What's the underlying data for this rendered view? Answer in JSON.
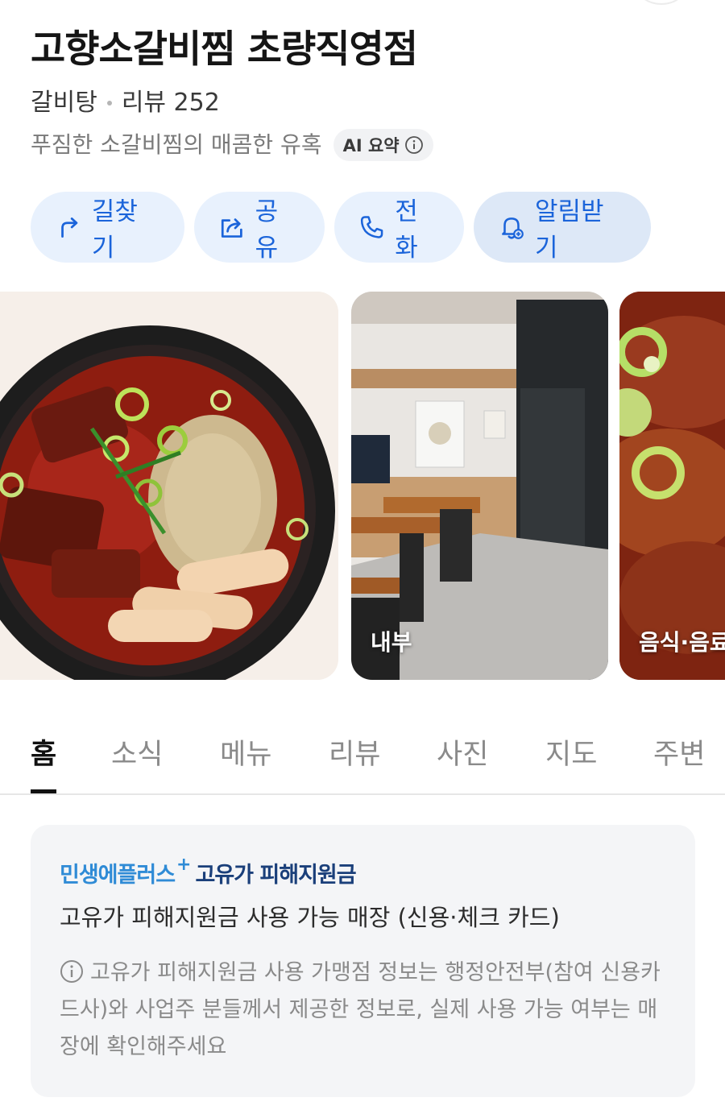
{
  "place": {
    "name": "고향소갈비찜 초량직영점",
    "category": "갈비탕",
    "review_label": "리뷰 252",
    "summary": "푸짐한 소갈비찜의 매콤한 유혹",
    "ai_badge": "AI 요약"
  },
  "actions": [
    {
      "label": "길찾기",
      "icon": "directions-icon"
    },
    {
      "label": "공유",
      "icon": "share-icon"
    },
    {
      "label": "전화",
      "icon": "phone-icon"
    },
    {
      "label": "알림받기",
      "icon": "bell-icon"
    }
  ],
  "photos": [
    {
      "caption": ""
    },
    {
      "caption": "내부"
    },
    {
      "caption": "음식·음료"
    }
  ],
  "tabs": [
    "홈",
    "소식",
    "메뉴",
    "리뷰",
    "사진",
    "지도",
    "주변"
  ],
  "active_tab": "홈",
  "notice": {
    "brand_primary": "민생에플러스",
    "brand_plus": "+",
    "brand_secondary": "고유가 피해지원금",
    "main": "고유가 피해지원금 사용 가능 매장 (신용·체크 카드)",
    "info": "고유가 피해지원금 사용 가맹점 정보는 행정안전부(참여 신용카드사)와 사업주 분들께서 제공한 정보로, 실제 사용 가능 여부는 매장에 확인해주세요"
  },
  "colors": {
    "accent": "#1b64da",
    "action_bg": "#e8f1fd",
    "brand_light": "#2f8bd6",
    "brand_dark": "#1a3f7a"
  }
}
